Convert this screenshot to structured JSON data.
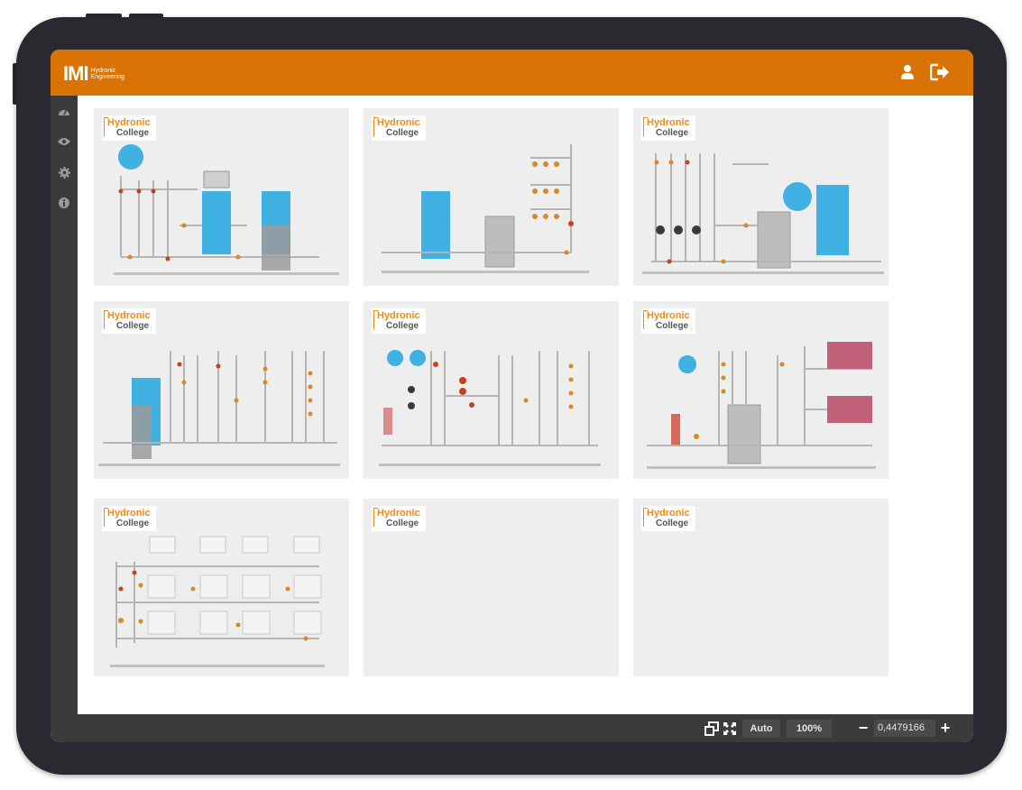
{
  "app": {
    "logo_text": "IMI",
    "logo_sub_line1": "Hydronic",
    "logo_sub_line2": "Engineering",
    "header_icons": [
      "user-icon",
      "logout-icon"
    ],
    "accent_color": "#d97306"
  },
  "sidebar": {
    "items": [
      {
        "icon": "dashboard-icon"
      },
      {
        "icon": "eye-icon"
      },
      {
        "icon": "gear-icon"
      },
      {
        "icon": "info-icon"
      }
    ]
  },
  "tiles": [
    {
      "brand_top": "Hydronic",
      "brand_bottom": "College"
    },
    {
      "brand_top": "Hydronic",
      "brand_bottom": "College"
    },
    {
      "brand_top": "Hydronic",
      "brand_bottom": "College"
    },
    {
      "brand_top": "Hydronic",
      "brand_bottom": "College"
    },
    {
      "brand_top": "Hydronic",
      "brand_bottom": "College"
    },
    {
      "brand_top": "Hydronic",
      "brand_bottom": "College"
    },
    {
      "brand_top": "Hydronic",
      "brand_bottom": "College"
    },
    {
      "brand_top": "Hydronic",
      "brand_bottom": "College"
    },
    {
      "brand_top": "Hydronic",
      "brand_bottom": "College"
    }
  ],
  "bottombar": {
    "icons": [
      "window-restore-icon",
      "fullscreen-icon"
    ],
    "auto_label": "Auto",
    "percent_label": "100%",
    "minus_label": "−",
    "zoom_value": "0,4479166",
    "plus_label": "+"
  }
}
